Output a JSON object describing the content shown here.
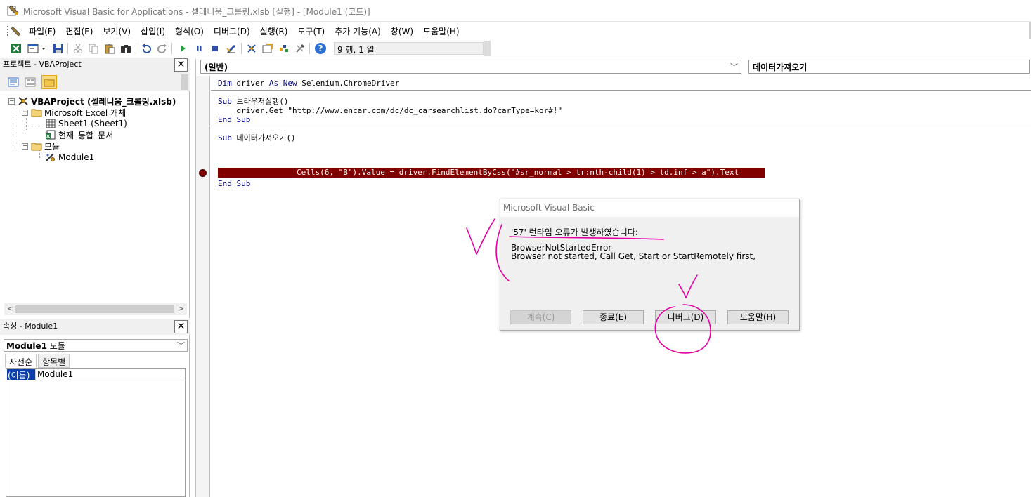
{
  "window": {
    "title": "Microsoft Visual Basic for Applications - 셀레니움_크롤링.xlsb [실행] - [Module1 (코드)]"
  },
  "menu": [
    "파일(F)",
    "편집(E)",
    "보기(V)",
    "삽입(I)",
    "형식(O)",
    "디버그(D)",
    "실행(R)",
    "도구(T)",
    "추가 기능(A)",
    "창(W)",
    "도움말(H)"
  ],
  "toolbar": {
    "position": "9 행, 1 열",
    "icons": [
      "excel-icon",
      "insert-userform-icon",
      "save-icon",
      "cut-icon",
      "copy-icon",
      "paste-icon",
      "find-icon",
      "undo-icon",
      "redo-icon",
      "run-icon",
      "break-icon",
      "reset-icon",
      "design-mode-icon",
      "project-explorer-icon",
      "properties-icon",
      "object-browser-icon",
      "toolbox-icon",
      "help-icon"
    ]
  },
  "project": {
    "title": "프로젝트 - VBAProject",
    "close": "✕",
    "tree": {
      "root": "VBAProject (셀레니움_크롤링.xlsb)",
      "excel_objects": "Microsoft Excel 개체",
      "sheet1": "Sheet1 (Sheet1)",
      "workbook": "현재_통합_문서",
      "modules": "모듈",
      "module1": "Module1"
    }
  },
  "properties": {
    "title": "속성 - Module1",
    "close": "✕",
    "object_name": "Module1",
    "object_type": "모듈",
    "tabs": [
      "사전순",
      "항목별"
    ],
    "rows": [
      {
        "key": "(이름)",
        "value": "Module1"
      }
    ]
  },
  "code": {
    "object_combo": "(일반)",
    "procedure_combo": "데이터가져오기",
    "lines": {
      "l1_kw1": "Dim",
      "l1_mid": " driver ",
      "l1_kw2": "As New",
      "l1_rest": " Selenium.ChromeDriver",
      "l2_kw": "Sub",
      "l2_rest": " 브라우저실행()",
      "l3": "    driver.Get \"http://www.encar.com/dc/dc_carsearchlist.do?carType=kor#!\"",
      "l4_kw": "End Sub",
      "l5_kw": "Sub",
      "l5_rest": " 데이터가져오기()",
      "l6_break": "Cells(6, \"B\").Value = driver.FindElementByCss(\"#sr_normal > tr:nth-child(1) > td.inf > a\").Text",
      "l7_kw": "End Sub"
    }
  },
  "dialog": {
    "title": "Microsoft Visual Basic",
    "error_line": "'57' 런타임 오류가 발생하였습니다:",
    "message_1": "BrowserNotStartedError",
    "message_2": "Browser not started, Call Get, Start or StartRemotely first,",
    "buttons": {
      "continue": "계속(C)",
      "end": "종료(E)",
      "debug": "디버그(D)",
      "help": "도움말(H)"
    }
  },
  "colors": {
    "break_highlight": "#800000",
    "keyword": "#00007f",
    "annotation": "#e500a4"
  }
}
